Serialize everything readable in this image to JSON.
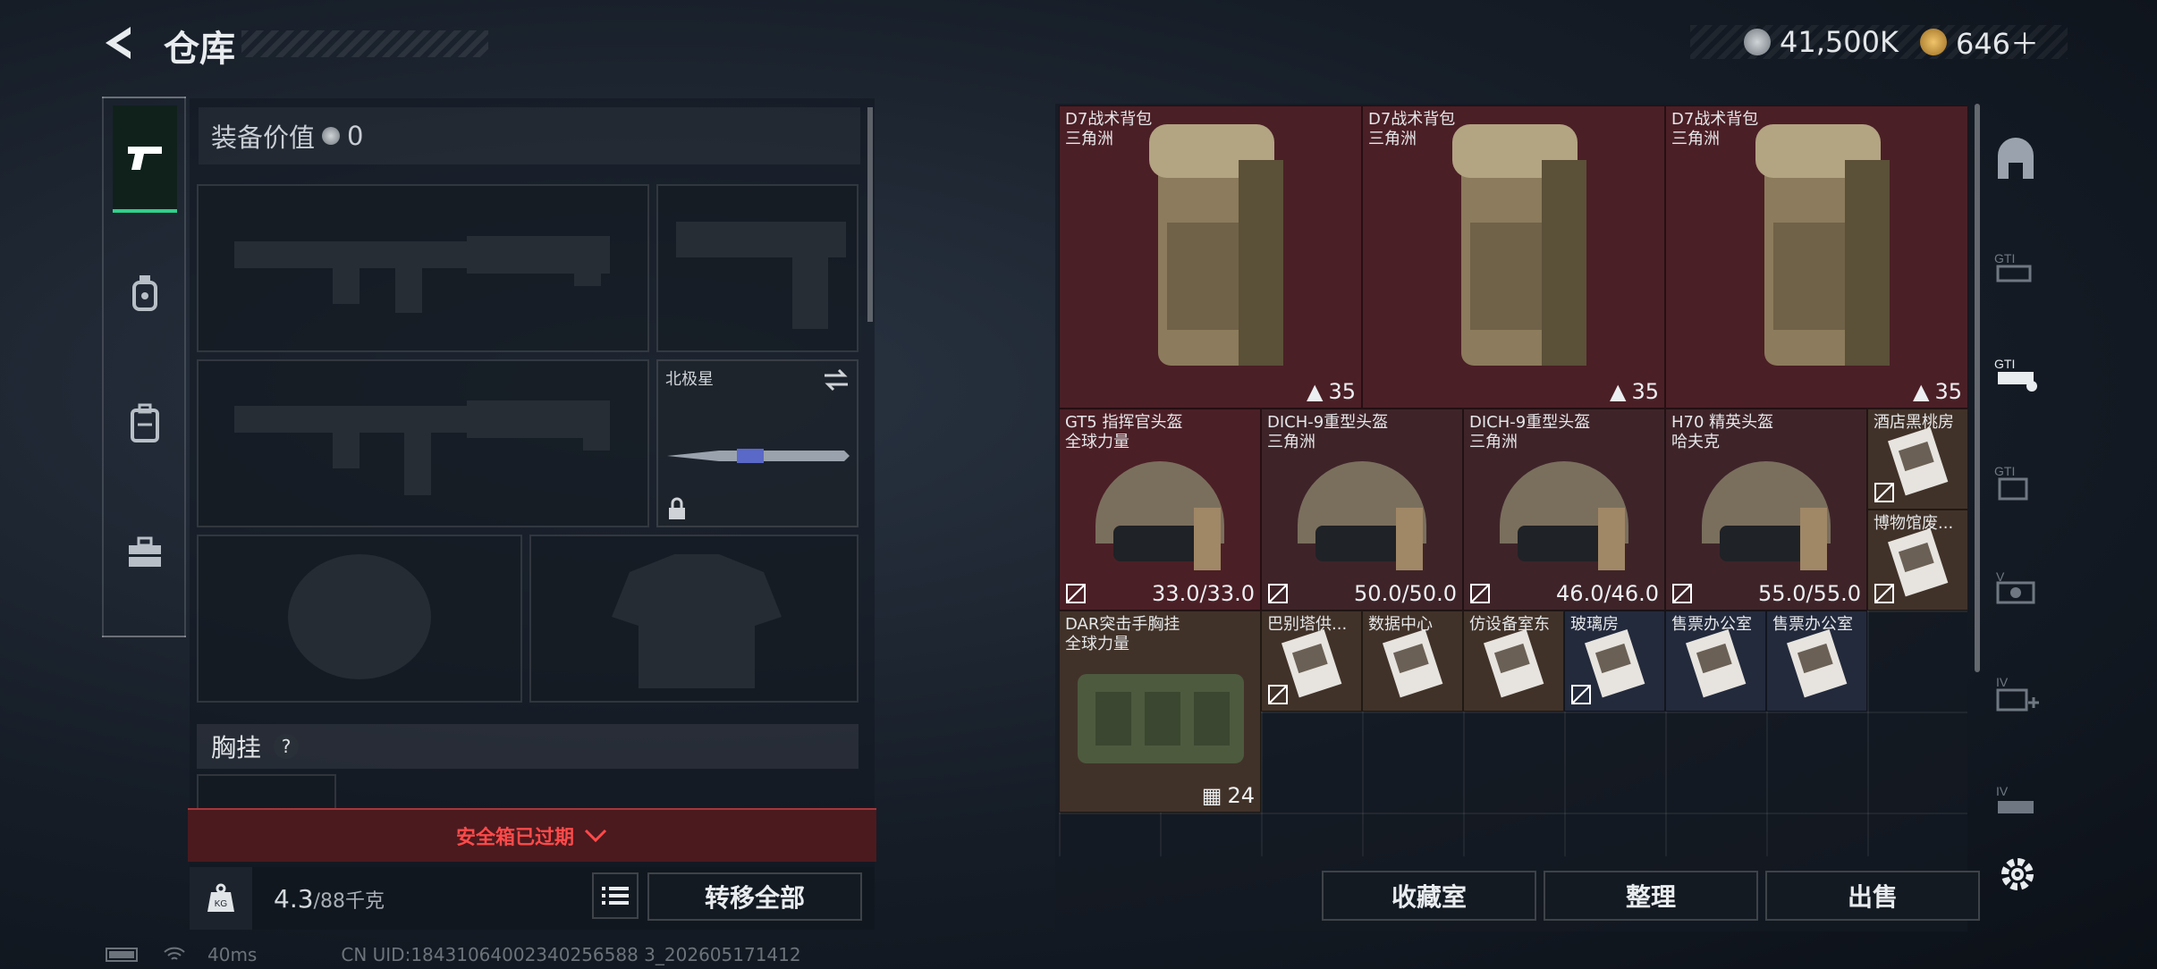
{
  "header": {
    "title": "仓库",
    "currency_1": "41,500K",
    "currency_2": "646＋"
  },
  "left": {
    "tabs": [
      "pistol-icon",
      "grenade-icon",
      "backpack-icon",
      "toolbox-icon"
    ],
    "equip_value_label": "装备价值",
    "equip_value": "0",
    "melee_label": "北极星",
    "chest_label": "胸挂",
    "chest_help": "?",
    "safe_notice": "安全箱已过期",
    "weight": "4.3",
    "weight_max": "/88千克",
    "transfer_all": "转移全部"
  },
  "stash": {
    "items": [
      {
        "name": "D7战术背包\n三角洲",
        "value": "35",
        "kind": "backpack"
      },
      {
        "name": "D7战术背包\n三角洲",
        "value": "35",
        "kind": "backpack"
      },
      {
        "name": "D7战术背包\n三角洲",
        "value": "35",
        "kind": "backpack"
      },
      {
        "name": "GT5 指挥官头盔\n全球力量",
        "value": "33.0/33.0",
        "kind": "helmet"
      },
      {
        "name": "DICH-9重型头盔\n三角洲",
        "value": "50.0/50.0",
        "kind": "helmet"
      },
      {
        "name": "DICH-9重型头盔\n三角洲",
        "value": "46.0/46.0",
        "kind": "helmet"
      },
      {
        "name": "H70 精英头盔\n哈夫克",
        "value": "55.0/55.0",
        "kind": "helmet"
      },
      {
        "name": "酒店黑桃房",
        "kind": "card"
      },
      {
        "name": "博物馆废...",
        "kind": "card"
      },
      {
        "name": "DAR突击手胸挂\n全球力量",
        "value": "24",
        "kind": "rig"
      },
      {
        "name": "巴别塔供...",
        "kind": "card"
      },
      {
        "name": "数据中心",
        "kind": "card"
      },
      {
        "name": "仿设备室东",
        "kind": "card"
      },
      {
        "name": "玻璃房",
        "kind": "card"
      },
      {
        "name": "售票办公室",
        "kind": "card"
      },
      {
        "name": "售票办公室",
        "kind": "card"
      }
    ],
    "buttons": {
      "collection": "收藏室",
      "sort": "整理",
      "sell": "出售"
    }
  },
  "footer": {
    "ping": "40ms",
    "uid": "CN UID:18431064002340256588 3_202605171412"
  }
}
